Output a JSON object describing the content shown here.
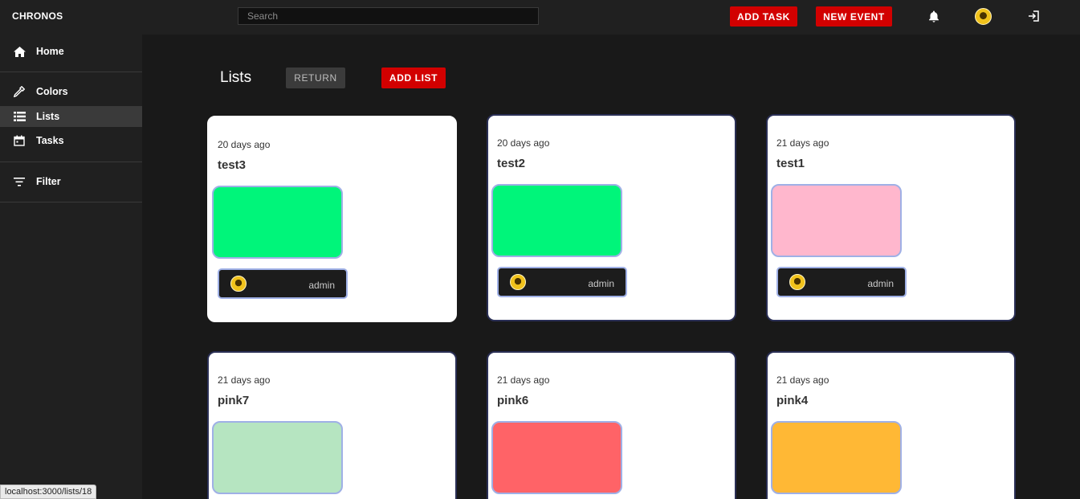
{
  "app": {
    "brand": "CHRONOS"
  },
  "search": {
    "placeholder": "Search"
  },
  "toolbar": {
    "add_task": "ADD TASK",
    "new_event": "NEW EVENT"
  },
  "sidebar": {
    "items": [
      {
        "label": "Home",
        "icon": "home-icon"
      },
      {
        "label": "Colors",
        "icon": "eyedropper-icon"
      },
      {
        "label": "Lists",
        "icon": "list-icon",
        "active": true
      },
      {
        "label": "Tasks",
        "icon": "calendar-icon"
      },
      {
        "label": "Filter",
        "icon": "filter-icon"
      }
    ]
  },
  "main": {
    "title": "Lists",
    "return_label": "RETURN",
    "add_list_label": "ADD LIST",
    "cards": [
      {
        "time": "20 days ago",
        "name": "test3",
        "color": "#00f57a",
        "owner": "admin"
      },
      {
        "time": "20 days ago",
        "name": "test2",
        "color": "#00f57a",
        "owner": "admin"
      },
      {
        "time": "21 days ago",
        "name": "test1",
        "color": "#ffb7cd",
        "owner": "admin"
      },
      {
        "time": "21 days ago",
        "name": "pink7",
        "color": "#b6e5c1"
      },
      {
        "time": "21 days ago",
        "name": "pink6",
        "color": "#ff6367"
      },
      {
        "time": "21 days ago",
        "name": "pink4",
        "color": "#ffb835"
      }
    ]
  },
  "status_bar": {
    "url": "localhost:3000/lists/18"
  },
  "colors": {
    "accent": "#d20000",
    "sidebar_active": "#3a3a3a"
  }
}
